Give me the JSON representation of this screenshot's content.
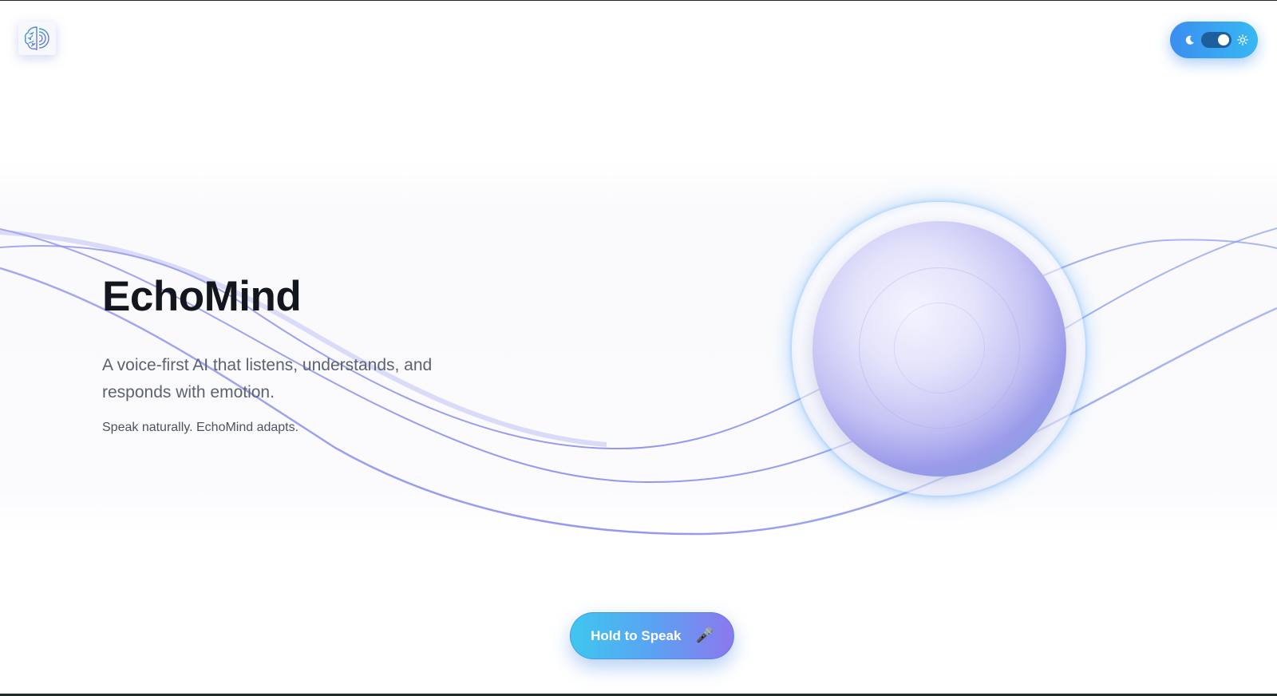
{
  "app": {
    "logo_icon": "brain-icon"
  },
  "theme_toggle": {
    "left_icon": "moon-icon",
    "right_icon": "sun-icon",
    "state": "on",
    "accent_start": "#3b8ef0",
    "accent_end": "#38b8f2"
  },
  "hero": {
    "title": "EchoMind",
    "subtitle": "A voice-first AI that listens, understands, and responds with emotion.",
    "tagline": "Speak naturally. EchoMind adapts."
  },
  "orb": {
    "icon": "voice-orb"
  },
  "action": {
    "speak_label": "Hold to Speak",
    "speak_icon": "microphone-icon",
    "accent_start": "#3ec7ef",
    "accent_end": "#8c78ee"
  }
}
